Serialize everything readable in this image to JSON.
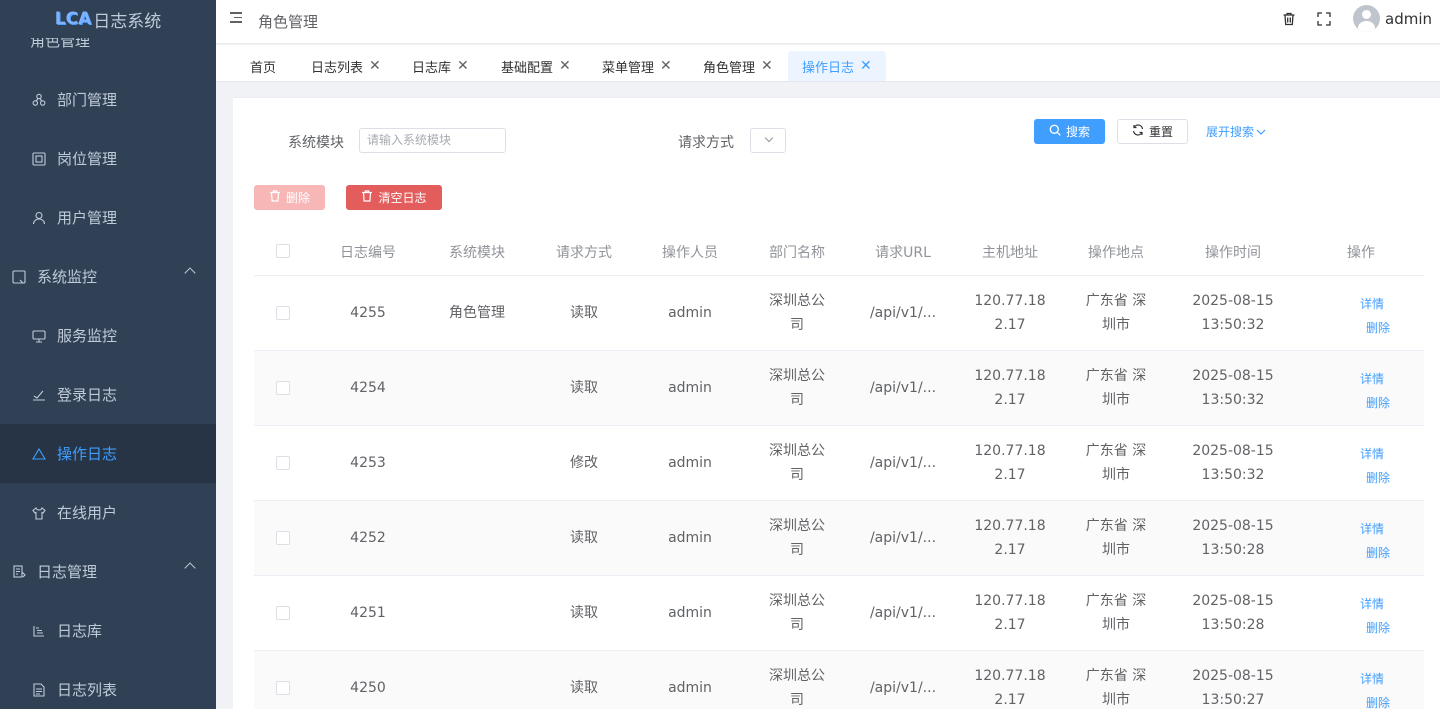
{
  "app": {
    "logo_mark": "LCA",
    "logo_text": "日志系统"
  },
  "sidebar": {
    "cut_item": "角色管理",
    "items": [
      {
        "label": "部门管理",
        "icon": "tree-icon"
      },
      {
        "label": "岗位管理",
        "icon": "post-icon"
      },
      {
        "label": "用户管理",
        "icon": "user-icon"
      },
      {
        "label": "系统监控",
        "icon": "monitor-icon",
        "group": true
      },
      {
        "label": "服务监控",
        "icon": "server-icon"
      },
      {
        "label": "登录日志",
        "icon": "logininfor-icon"
      },
      {
        "label": "操作日志",
        "icon": "form-icon",
        "active": true
      },
      {
        "label": "在线用户",
        "icon": "online-icon"
      },
      {
        "label": "日志管理",
        "icon": "log-icon",
        "group": true
      },
      {
        "label": "日志库",
        "icon": "library-icon"
      },
      {
        "label": "日志列表",
        "icon": "list-icon"
      }
    ]
  },
  "header": {
    "breadcrumb": "角色管理",
    "username": "admin"
  },
  "tags": [
    {
      "label": "首页",
      "closable": false
    },
    {
      "label": "日志列表",
      "closable": true
    },
    {
      "label": "日志库",
      "closable": true
    },
    {
      "label": "基础配置",
      "closable": true
    },
    {
      "label": "菜单管理",
      "closable": true
    },
    {
      "label": "角色管理",
      "closable": true
    },
    {
      "label": "操作日志",
      "closable": true,
      "active": true
    }
  ],
  "search": {
    "module_label": "系统模块",
    "module_placeholder": "请输入系统模块",
    "method_label": "请求方式",
    "search_button": "搜索",
    "reset_button": "重置",
    "expand_link": "展开搜索"
  },
  "toolbar": {
    "delete_button": "删除",
    "clear_button": "清空日志"
  },
  "table": {
    "headers": [
      "日志编号",
      "系统模块",
      "请求方式",
      "操作人员",
      "部门名称",
      "请求URL",
      "主机地址",
      "操作地点",
      "操作时间",
      "操作"
    ],
    "rows": [
      {
        "id": "4255",
        "module": "角色管理",
        "method": "读取",
        "operator": "admin",
        "dept_1": "深圳总公",
        "dept_2": "司",
        "url": "/api/v1/...",
        "ip_1": "120.77.18",
        "ip_2": "2.17",
        "loc_1": "广东省 深",
        "loc_2": "圳市",
        "date": "2025-08-15",
        "time": "13:50:32"
      },
      {
        "id": "4254",
        "module": "",
        "method": "读取",
        "operator": "admin",
        "dept_1": "深圳总公",
        "dept_2": "司",
        "url": "/api/v1/...",
        "ip_1": "120.77.18",
        "ip_2": "2.17",
        "loc_1": "广东省 深",
        "loc_2": "圳市",
        "date": "2025-08-15",
        "time": "13:50:32"
      },
      {
        "id": "4253",
        "module": "",
        "method": "修改",
        "operator": "admin",
        "dept_1": "深圳总公",
        "dept_2": "司",
        "url": "/api/v1/...",
        "ip_1": "120.77.18",
        "ip_2": "2.17",
        "loc_1": "广东省 深",
        "loc_2": "圳市",
        "date": "2025-08-15",
        "time": "13:50:32"
      },
      {
        "id": "4252",
        "module": "",
        "method": "读取",
        "operator": "admin",
        "dept_1": "深圳总公",
        "dept_2": "司",
        "url": "/api/v1/...",
        "ip_1": "120.77.18",
        "ip_2": "2.17",
        "loc_1": "广东省 深",
        "loc_2": "圳市",
        "date": "2025-08-15",
        "time": "13:50:28"
      },
      {
        "id": "4251",
        "module": "",
        "method": "读取",
        "operator": "admin",
        "dept_1": "深圳总公",
        "dept_2": "司",
        "url": "/api/v1/...",
        "ip_1": "120.77.18",
        "ip_2": "2.17",
        "loc_1": "广东省 深",
        "loc_2": "圳市",
        "date": "2025-08-15",
        "time": "13:50:28"
      },
      {
        "id": "4250",
        "module": "",
        "method": "读取",
        "operator": "admin",
        "dept_1": "深圳总公",
        "dept_2": "司",
        "url": "/api/v1/...",
        "ip_1": "120.77.18",
        "ip_2": "2.17",
        "loc_1": "广东省 深",
        "loc_2": "圳市",
        "date": "2025-08-15",
        "time": "13:50:27"
      }
    ],
    "action_detail": "详情",
    "action_delete": "删除"
  },
  "colors": {
    "sidebar_bg": "#304156",
    "sidebar_active_bg": "#263445",
    "accent": "#409eff",
    "danger": "#e35d5d"
  }
}
